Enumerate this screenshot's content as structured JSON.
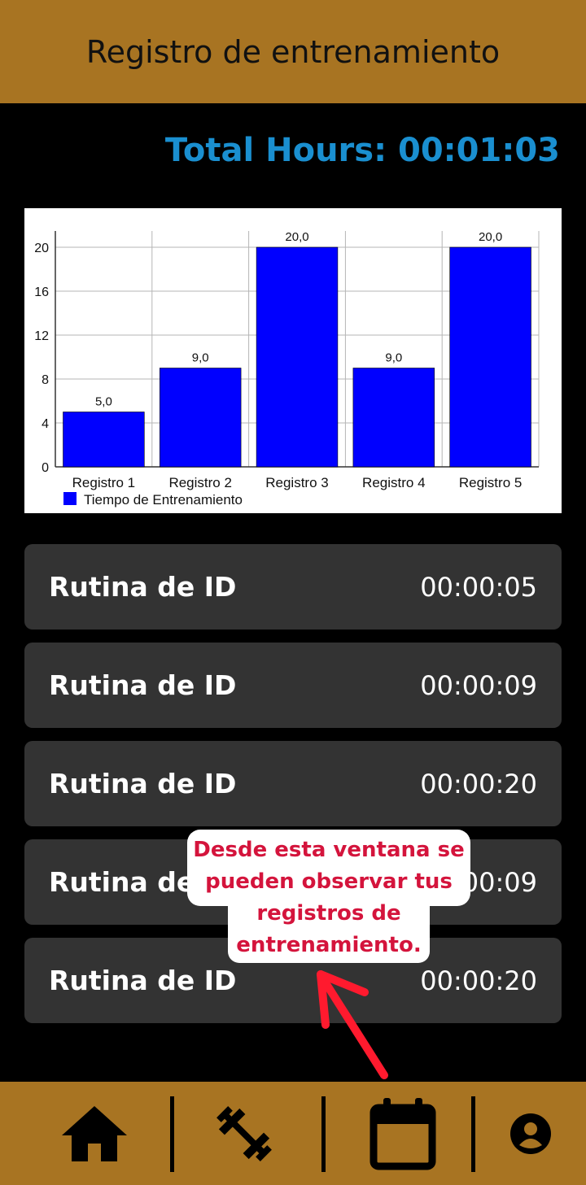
{
  "header": {
    "title": "Registro de entrenamiento"
  },
  "total_hours": "Total Hours: 00:01:03",
  "chart_data": {
    "type": "bar",
    "categories": [
      "Registro 1",
      "Registro 2",
      "Registro 3",
      "Registro 4",
      "Registro 5"
    ],
    "series": [
      {
        "name": "Tiempo de Entrenamiento",
        "values": [
          5,
          9,
          20,
          9,
          20
        ],
        "labels": [
          "5,0",
          "9,0",
          "20,0",
          "9,0",
          "20,0"
        ]
      }
    ],
    "ylim": [
      0,
      20
    ],
    "yticks": [
      0,
      4,
      8,
      12,
      16,
      20
    ],
    "grid": true,
    "legend_position": "bottom-left",
    "bar_color": "#0000ff"
  },
  "records": [
    {
      "label": "Rutina de ID",
      "time": "00:00:05"
    },
    {
      "label": "Rutina de ID",
      "time": "00:00:09"
    },
    {
      "label": "Rutina de ID",
      "time": "00:00:20"
    },
    {
      "label": "Rutina de ID",
      "time": "00:00:09"
    },
    {
      "label": "Rutina de ID",
      "time": "00:00:20"
    }
  ],
  "callout": {
    "lines": [
      "Desde esta ventana se",
      "pueden observar tus",
      "registros de",
      "entrenamiento."
    ]
  },
  "nav": {
    "icons": [
      "home-icon",
      "dumbbell-icon",
      "calendar-icon",
      "account-icon"
    ]
  },
  "colors": {
    "accent": "#a87422",
    "total_text": "#1a8fd0",
    "card_bg": "#333333",
    "callout_text": "#d4143c",
    "arrow": "#ff1a2e"
  }
}
